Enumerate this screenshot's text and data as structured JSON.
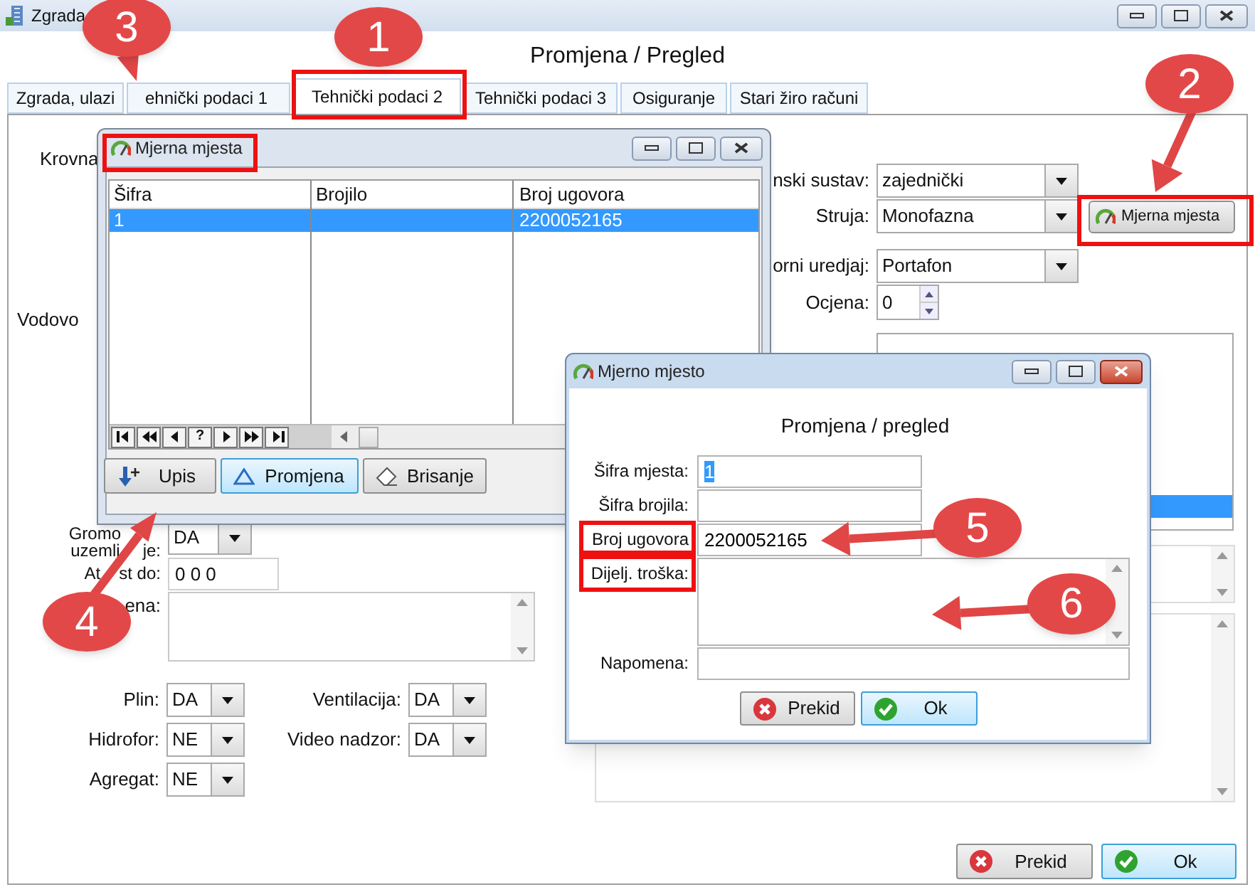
{
  "main": {
    "title": "Zgrada",
    "heading": "Promjena / Pregled",
    "tabs": [
      {
        "label": "Zgrada, ulazi",
        "selected": false
      },
      {
        "label": "ehnički podaci 1",
        "selected": false
      },
      {
        "label": "Tehnički podaci 2",
        "selected": true
      },
      {
        "label": "Tehnički podaci 3",
        "selected": false
      },
      {
        "label": "Osiguranje",
        "selected": false
      },
      {
        "label": "Stari žiro računi",
        "selected": false
      }
    ],
    "cut_labels": [
      "Krovna",
      "Vodovo"
    ],
    "right_fields": [
      {
        "label": "nski sustav:",
        "value": "zajednički",
        "kind": "combo"
      },
      {
        "label": "Struja:",
        "value": "Monofazna",
        "kind": "combo"
      },
      {
        "label": "orni uredjaj:",
        "value": "Portafon",
        "kind": "combo"
      },
      {
        "label": "Ocjena:",
        "value": "0",
        "kind": "spinner"
      }
    ],
    "meter_button": "Mjerna mjesta",
    "grounding": {
      "label_parts": [
        "Gromo",
        "uzemlj",
        "je:"
      ],
      "value": "DA"
    },
    "attest": {
      "label_parts": [
        "At",
        "st do:"
      ],
      "value": "0 0 0"
    },
    "note_label": "ena:",
    "selects_left": [
      {
        "label": "Plin:",
        "value": "DA"
      },
      {
        "label": "Hidrofor:",
        "value": "NE"
      },
      {
        "label": "Agregat:",
        "value": "NE"
      }
    ],
    "selects_right": [
      {
        "label": "Ventilacija:",
        "value": "DA"
      },
      {
        "label": "Video nadzor:",
        "value": "DA"
      }
    ],
    "buttons": [
      {
        "label": "Prekid",
        "kind": "cancel"
      },
      {
        "label": "Ok",
        "kind": "ok"
      }
    ]
  },
  "list_dialog": {
    "title": "Mjerna mjesta",
    "columns": [
      "Šifra",
      "Brojilo",
      "Broj ugovora"
    ],
    "rows": [
      {
        "sifra": "1",
        "broj_ugovora": "2200052165",
        "selected": true
      }
    ],
    "nav_help": "?",
    "buttons": [
      {
        "label": "Upis",
        "kind": "add",
        "focused": false
      },
      {
        "label": "Promjena",
        "kind": "edit",
        "focused": true
      },
      {
        "label": "Brisanje",
        "kind": "delete",
        "focused": false
      }
    ]
  },
  "edit_dialog": {
    "title": "Mjerno mjesto",
    "heading": "Promjena / pregled",
    "fields": [
      {
        "label": "Šifra mjesta:",
        "value": "1",
        "kind": "line",
        "text_selected": true
      },
      {
        "label": "Šifra brojila:",
        "kind": "line"
      },
      {
        "label": "Broj ugovora",
        "value": "2200052165",
        "kind": "line",
        "text_selected": false
      },
      {
        "label": "Dijelj. troška:",
        "kind": "memo"
      },
      {
        "label": "Napomena:",
        "kind": "wide"
      }
    ],
    "buttons": [
      {
        "label": "Prekid",
        "kind": "cancel"
      },
      {
        "label": "Ok",
        "kind": "ok"
      }
    ]
  },
  "callouts": [
    {
      "number": "1"
    },
    {
      "number": "2"
    },
    {
      "number": "3"
    },
    {
      "number": "4"
    },
    {
      "number": "5"
    },
    {
      "number": "6"
    }
  ]
}
